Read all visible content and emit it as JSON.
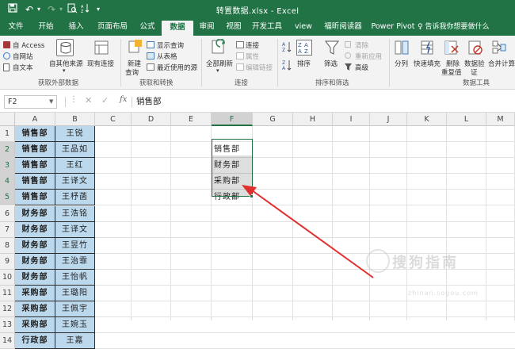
{
  "window": {
    "title": "转置数据.xlsx - Excel",
    "icons": [
      "save-icon",
      "undo-icon",
      "redo-icon",
      "print-preview-icon",
      "customize-icon"
    ]
  },
  "tabs": [
    {
      "label": "文件",
      "active": false
    },
    {
      "label": "开始",
      "active": false
    },
    {
      "label": "插入",
      "active": false
    },
    {
      "label": "页面布局",
      "active": false
    },
    {
      "label": "公式",
      "active": false
    },
    {
      "label": "数据",
      "active": true
    },
    {
      "label": "审阅",
      "active": false
    },
    {
      "label": "视图",
      "active": false
    },
    {
      "label": "开发工具",
      "active": false
    },
    {
      "label": "view",
      "active": false
    },
    {
      "label": "福昕阅读器",
      "active": false
    },
    {
      "label": "Power Pivot",
      "active": false
    }
  ],
  "tell_me": "♀ 告诉我你想要做什么",
  "ribbon": {
    "external": {
      "from_access": "自 Access",
      "from_web": "自网站",
      "from_text": "自文本",
      "other_sources": "自其他来源",
      "existing_connections": "现有连接",
      "group_label": "获取外部数据"
    },
    "transform": {
      "new_query": "新建",
      "new_query_2": "查询",
      "show_queries": "显示查询",
      "from_table": "从表格",
      "recent_sources": "最近使用的源",
      "group_label": "获取和转换"
    },
    "connections": {
      "refresh_all": "全部刷新",
      "connections": "连接",
      "properties": "属性",
      "edit_links": "编辑链接",
      "group_label": "连接"
    },
    "sort_filter": {
      "sort": "排序",
      "filter": "筛选",
      "clear": "清除",
      "reapply": "重新应用",
      "advanced": "高级",
      "group_label": "排序和筛选"
    },
    "data_tools": {
      "text_to_columns": "分列",
      "flash_fill": "快速填充",
      "remove_duplicates": "删除",
      "remove_duplicates_2": "重复值",
      "data_validation": "数据验",
      "data_validation_2": "证",
      "consolidate": "合并计算",
      "group_label": "数据工具"
    }
  },
  "formula_bar": {
    "name_box": "F2",
    "content": "销售部",
    "fx": "fx"
  },
  "columns": [
    "A",
    "B",
    "C",
    "D",
    "E",
    "F",
    "G",
    "H",
    "I",
    "J",
    "K",
    "L",
    "M"
  ],
  "selected_column": "F",
  "rows": [
    "1",
    "2",
    "3",
    "4",
    "5",
    "6",
    "7",
    "8",
    "9",
    "10",
    "11",
    "12",
    "13",
    "14"
  ],
  "selected_rows": [
    "2",
    "3",
    "4",
    "5"
  ],
  "cells_A": [
    "销售部",
    "销售部",
    "销售部",
    "销售部",
    "销售部",
    "财务部",
    "财务部",
    "财务部",
    "财务部",
    "财务部",
    "采购部",
    "采购部",
    "采购部",
    "行政部"
  ],
  "cells_B": [
    "王锐",
    "王品如",
    "王红",
    "王译文",
    "王杼菡",
    "王浩铭",
    "王译文",
    "王昱竹",
    "王治霏",
    "王怡帆",
    "王璐阳",
    "王佩宇",
    "王婉玉",
    "王嘉"
  ],
  "cells_F": [
    "销售部",
    "财务部",
    "采购部",
    "行政部"
  ],
  "watermark": {
    "text": "搜狗指南",
    "url": "zhinan.sogou.com"
  },
  "colors": {
    "excel_green": "#217346",
    "cell_fill": "#bcd8ec",
    "arrow": "#e03030"
  }
}
